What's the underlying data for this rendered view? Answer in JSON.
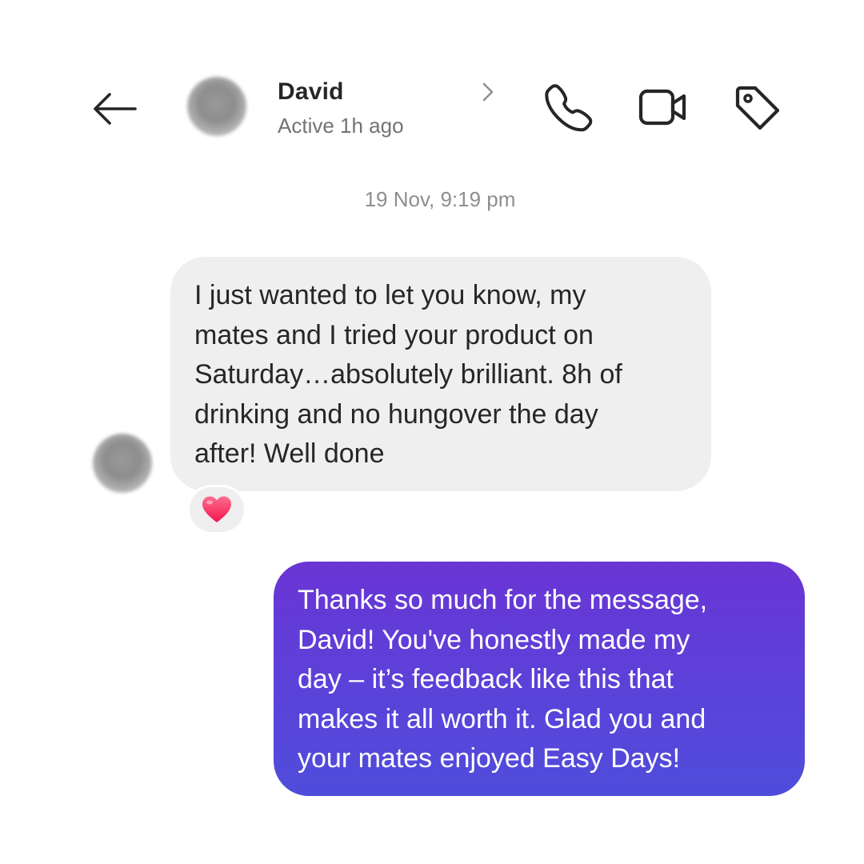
{
  "header": {
    "back_icon": "arrow-left-icon",
    "contact_name": "David",
    "contact_status": "Active 1h ago",
    "actions": {
      "call_icon": "phone-icon",
      "video_icon": "video-camera-icon",
      "tag_icon": "tag-icon"
    }
  },
  "thread": {
    "timestamp": "19 Nov, 9:19 pm",
    "incoming": {
      "lines": [
        "I just wanted to let you know, my",
        "mates and I tried your product on",
        "Saturday…absolutely brilliant. 8h of",
        "drinking and no hungover the day",
        "after! Well done"
      ],
      "reaction_icon": "red-heart-icon"
    },
    "outgoing": {
      "lines": [
        "Thanks so much for the message,",
        "David! You've honestly made my",
        "day – it’s feedback like this that",
        "makes it all worth it. Glad you and",
        "your mates enjoyed Easy Days!"
      ]
    }
  },
  "colors": {
    "incoming_bubble": "#efefef",
    "outgoing_gradient_top": "#6a35d4",
    "outgoing_gradient_bottom": "#4f4ddb",
    "heart": "#ff3b6b"
  }
}
